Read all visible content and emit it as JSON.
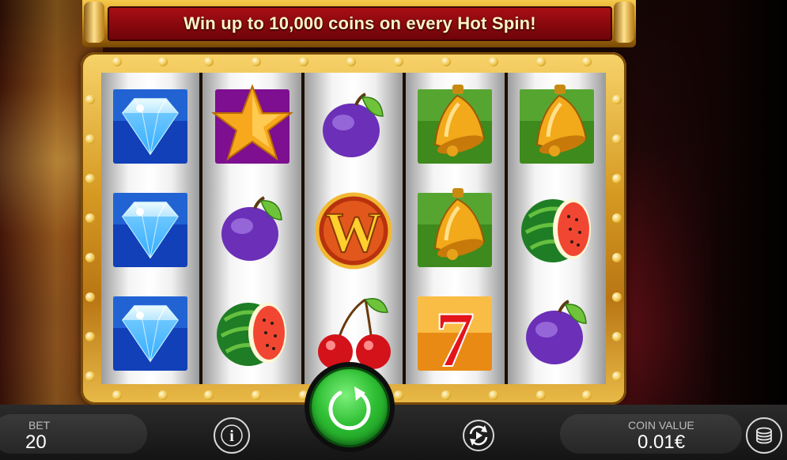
{
  "banner": {
    "text": "Win up to 10,000 coins on every Hot Spin!"
  },
  "reels": [
    [
      "diamond",
      "diamond",
      "diamond"
    ],
    [
      "star",
      "plum",
      "watermelon"
    ],
    [
      "plum",
      "wild",
      "cherries"
    ],
    [
      "bell",
      "bell",
      "seven"
    ],
    [
      "bell",
      "watermelon",
      "plum"
    ]
  ],
  "wild_letter": "W",
  "seven_glyph": "7",
  "bottom_bar": {
    "bet_label": "BET",
    "bet_value": "20",
    "coin_label": "COIN VALUE",
    "coin_value": "0.01€",
    "info_glyph": "i"
  },
  "icons": {
    "info": "info-icon",
    "spin": "spin-arrow-icon",
    "autoplay": "autoplay-icon",
    "coins": "coin-stack-icon"
  },
  "colors": {
    "banner_red": "#a80e14",
    "frame_gold": "#d69a22",
    "spin_green": "#2fbf34",
    "bar_dark": "#1c1c1c"
  }
}
